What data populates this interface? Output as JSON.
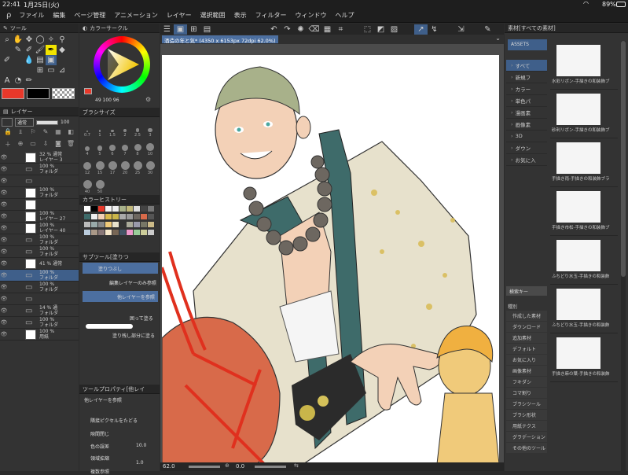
{
  "status_bar": {
    "time": "22:41",
    "date": "1月25日(火)",
    "battery": "89%"
  },
  "menu": [
    "ファイル",
    "編集",
    "ページ管理",
    "アニメーション",
    "レイヤー",
    "選択範囲",
    "表示",
    "フィルター",
    "ウィンドウ",
    "ヘルプ"
  ],
  "tool_panel": {
    "title": "ツール"
  },
  "layer_panel": {
    "title": "レイヤー",
    "blend_mode": "通常",
    "opacity": "100",
    "layers": [
      {
        "l1": "32 % 通常",
        "l2": "レイヤー 3",
        "type": "layer"
      },
      {
        "l1": "100 %",
        "l2": "フォルダ",
        "type": "folder"
      },
      {
        "l1": "",
        "l2": "",
        "type": "folder"
      },
      {
        "l1": "100 %",
        "l2": "フォルダ",
        "type": "layer"
      },
      {
        "l1": "",
        "l2": "",
        "type": "layer"
      },
      {
        "l1": "100 %",
        "l2": "レイヤー 27",
        "type": "layer"
      },
      {
        "l1": "100 %",
        "l2": "レイヤー 40",
        "type": "layer"
      },
      {
        "l1": "100 %",
        "l2": "フォルダ",
        "type": "folder"
      },
      {
        "l1": "100 %",
        "l2": "フォルダ",
        "type": "folder"
      },
      {
        "l1": "41 % 通常",
        "l2": "",
        "type": "layer"
      },
      {
        "l1": "100 %",
        "l2": "フォルダ",
        "type": "folder"
      },
      {
        "l1": "100 %",
        "l2": "フォルダ",
        "type": "folder"
      },
      {
        "l1": "",
        "l2": "",
        "type": "folder"
      },
      {
        "l1": "14 % 通",
        "l2": "フォルダ",
        "type": "folder"
      },
      {
        "l1": "100 %",
        "l2": "フォルダ",
        "type": "folder"
      },
      {
        "l1": "100 %",
        "l2": "用紙",
        "type": "layer"
      }
    ]
  },
  "color_circle": {
    "title": "カラーサークル",
    "hsv": "49 100 96"
  },
  "brush_size": {
    "title": "ブラシサイズ",
    "sizes": [
      "0.7",
      "1",
      "1.5",
      "2",
      "2.5",
      "3",
      "4",
      "5",
      "6",
      "7",
      "8",
      "10",
      "12",
      "15",
      "17",
      "20",
      "25",
      "30",
      "40",
      "50"
    ]
  },
  "color_history": {
    "title": "カラーヒストリー"
  },
  "sub_tool": {
    "title": "サブツール[塗りつ",
    "items": [
      "塗りつぶし",
      "編集レイヤーのみ参照",
      "他レイヤーを参照",
      "囲って塗る",
      "塗り残し部分に塗る"
    ]
  },
  "tool_property": {
    "title": "ツールプロパティ[他レイ",
    "subtitle": "他レイヤーを参照",
    "rows": [
      {
        "label": "隣接ピクセルをたどる",
        "value": ""
      },
      {
        "label": "隙間閉じ",
        "value": ""
      },
      {
        "label": "色の誤差",
        "value": "10.0"
      },
      {
        "label": "領域拡縮",
        "value": "1.0"
      },
      {
        "label": "複数参照",
        "value": ""
      }
    ]
  },
  "canvas": {
    "doc_tab": "酒造の年と気* (4350 x 6153px 72dpi 62.0%)",
    "zoom": "62.0",
    "zoom2": "0.0"
  },
  "material_panel": {
    "title": "素材[すべての素材]",
    "assets_tab": "ASSETS",
    "tree": [
      "すべて",
      "新規フ",
      "カラー",
      "単色パ",
      "漫画素",
      "画像素",
      "3D",
      "ダウン",
      "お気に入"
    ],
    "search_placeholder": "検索キー",
    "tags_header": "種別",
    "tags": [
      "作成した素材",
      "ダウンロード",
      "追加素材",
      "デフォルト",
      "お気に入り",
      "画像素材",
      "フキダシ",
      "コマ割り",
      "ブラシツール",
      "ブラシ形状",
      "用紙テクス",
      "グラデーション",
      "その他のツール"
    ],
    "assets": [
      "水彩リボン-手描きの和装飾ブラシ集",
      "砂利リボン-手描きの和装飾ブラシ集",
      "手描き雨-手描きの和装飾ブラシ集",
      "手描き市松-手描きの和装飾ブラシ集",
      "ふちどり水玉-手描きの和装飾ブラシ集",
      "ふちどり水玉-手描きの和装飾ブラシ集",
      "手描き麻の葉-手描きの和装飾ブラシ集"
    ]
  },
  "colors": {
    "main": "#e8382a",
    "sub": "#000000",
    "accent": "#3f5f8a"
  }
}
